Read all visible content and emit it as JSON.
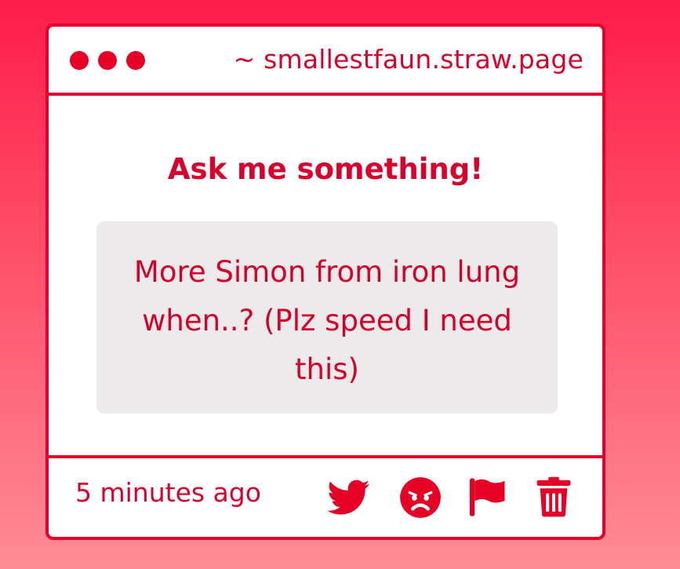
{
  "window": {
    "url": "~ smallestfaun.straw.page"
  },
  "content": {
    "heading": "Ask me something!",
    "question": "More Simon from iron lung when..? (Plz speed I need this)"
  },
  "footer": {
    "timestamp": "5 minutes ago",
    "actions": [
      {
        "icon": "twitter-icon"
      },
      {
        "icon": "angry-face-icon"
      },
      {
        "icon": "flag-icon"
      },
      {
        "icon": "trash-icon"
      }
    ]
  },
  "colors": {
    "accent": "#e3002d",
    "text": "#d9002b",
    "question_bg": "#edeaeb",
    "background_top": "#ff1c4b",
    "background_bottom": "#ff8c96"
  }
}
